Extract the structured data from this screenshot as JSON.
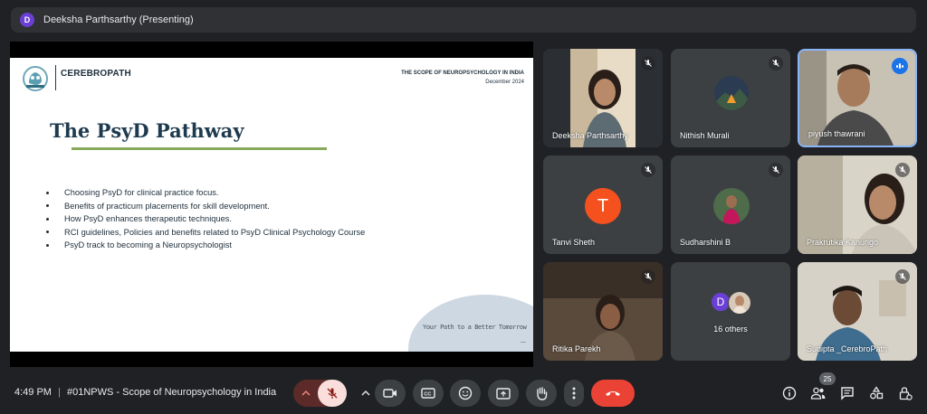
{
  "presenter": {
    "avatar_letter": "D",
    "label": "Deeksha Parthsarthy (Presenting)"
  },
  "slide": {
    "logo_name": "CEREBROPATH",
    "header_title": "THE SCOPE OF NEUROPSYCHOLOGY IN INDIA",
    "header_date": "December 2024",
    "title": "The PsyD Pathway",
    "bullets": [
      "Choosing PsyD for clinical practice focus.",
      "Benefits of practicum placements for skill development.",
      "How PsyD enhances therapeutic techniques.",
      "RCI guidelines, Policies and benefits related to PsyD Clinical Psychology Course",
      "PsyD track to becoming a Neuropsychologist"
    ],
    "tagline": "Your Path to a Better Tomorrow",
    "tagline_mark": "—",
    "colors": {
      "title": "#1e3a4f",
      "underline": "#86a95a",
      "blob": "#cdd8e2"
    }
  },
  "participants": [
    {
      "name": "Deeksha Parthsarthy",
      "muted": true,
      "speaking": false,
      "view": "video"
    },
    {
      "name": "Nithish Murali",
      "muted": true,
      "speaking": false,
      "view": "image"
    },
    {
      "name": "piyush thawrani",
      "muted": false,
      "speaking": true,
      "view": "video"
    },
    {
      "name": "Tanvi Sheth",
      "muted": true,
      "speaking": false,
      "view": "letter",
      "letter": "T",
      "color": "#f4511e"
    },
    {
      "name": "Sudharshini B",
      "muted": true,
      "speaking": false,
      "view": "image"
    },
    {
      "name": "Prakrutika Kanungo",
      "muted": true,
      "speaking": false,
      "view": "video"
    },
    {
      "name": "Ritika Parekh",
      "muted": true,
      "speaking": false,
      "view": "video"
    },
    {
      "name": "16 others",
      "muted": false,
      "speaking": false,
      "view": "group",
      "letter": "D"
    },
    {
      "name": "Sudipta _CerebroPath",
      "muted": true,
      "speaking": false,
      "view": "video"
    }
  ],
  "meeting": {
    "time": "4:49 PM",
    "separator": "|",
    "title": "#01NPWS - Scope of Neuropsychology in India"
  },
  "controls": {
    "icons": [
      "chevron-up-icon",
      "mic-off-icon",
      "chevron-up-icon",
      "camera-icon",
      "captions-icon",
      "emoji-icon",
      "present-icon",
      "raise-hand-icon",
      "more-options-icon",
      "end-call-icon"
    ],
    "end_call_color": "#ea4335",
    "mic_off_bg": "#f9dedc"
  },
  "right_controls": {
    "icons": [
      "info-icon",
      "people-icon",
      "chat-icon",
      "activities-icon",
      "host-controls-icon"
    ],
    "people_count": "25"
  }
}
